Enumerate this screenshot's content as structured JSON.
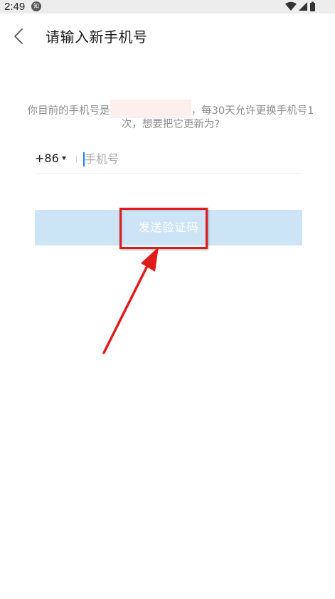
{
  "status_bar": {
    "time": "2:49",
    "notification_icon": "zhihu-notification-icon",
    "notification_glyph": "知",
    "icons": [
      "wifi-icon",
      "signal-icon",
      "battery-icon"
    ]
  },
  "header": {
    "back_icon": "chevron-left-icon",
    "title": "请输入新手机号"
  },
  "info": {
    "line1_prefix": "你目前的手机号是",
    "line1_suffix": "，每30天允许更换手机号1",
    "line2": "次，想要把它更新为?"
  },
  "phone_form": {
    "country_code": "+86",
    "dropdown_icon": "caret-down-icon",
    "input_value": "",
    "input_placeholder": "手机号"
  },
  "send_button": {
    "label": "发送验证码",
    "state": "disabled"
  },
  "annotation": {
    "color": "#e01b1b",
    "type": "highlight-box-with-arrow"
  },
  "colors": {
    "button_disabled_bg": "#cde4f7",
    "caret": "#1a7ff2",
    "muted_text": "#8c8c8c",
    "masked_phone_bg": "#fdf0ec"
  }
}
